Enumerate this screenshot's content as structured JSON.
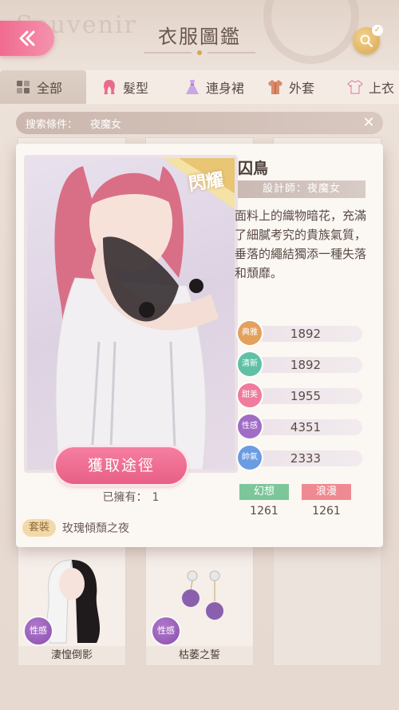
{
  "header": {
    "title": "衣服圖鑑",
    "bg_text": "Souvenir",
    "back_icon": "double-chevron-left-icon",
    "search_icon": "search-icon"
  },
  "tabs": [
    {
      "label": "全部",
      "icon": "grid-icon",
      "active": true
    },
    {
      "label": "髮型",
      "icon": "hair-icon",
      "active": false
    },
    {
      "label": "連身裙",
      "icon": "dress-icon",
      "active": false
    },
    {
      "label": "外套",
      "icon": "coat-icon",
      "active": false
    },
    {
      "label": "上衣",
      "icon": "shirt-icon",
      "active": false
    }
  ],
  "search_condition": {
    "label": "搜索條件：",
    "value": "夜魔女"
  },
  "detail": {
    "badge": "閃耀",
    "name": "囚鳥",
    "designer": "設計師：夜魔女",
    "description": "面料上的織物暗花，充滿了細膩考究的貴族氣質，垂落的繩結獨添一種失落和頹靡。",
    "get_button": "獲取途徑",
    "owned_label": "已擁有：",
    "owned_count": "1",
    "suit_tag": "套裝",
    "suit_name": "玫瑰傾頹之夜",
    "attributes": [
      {
        "label": "典雅",
        "value": "1892",
        "color": "#e3a15c"
      },
      {
        "label": "清新",
        "value": "1892",
        "color": "#5fc0a6"
      },
      {
        "label": "甜美",
        "value": "1955",
        "color": "#ef7c9c"
      },
      {
        "label": "性感",
        "value": "4351",
        "color": "#a06cc6"
      },
      {
        "label": "帥氣",
        "value": "2333",
        "color": "#6b9be0"
      }
    ],
    "tags": [
      {
        "label": "幻想",
        "value": "1261",
        "color": "#7cc69a"
      },
      {
        "label": "浪漫",
        "value": "1261",
        "color": "#ef8a92"
      }
    ]
  },
  "grid_items": [
    {
      "name": "淒惶倒影",
      "stat": "性感"
    },
    {
      "name": "枯萎之誓",
      "stat": "性感"
    }
  ]
}
